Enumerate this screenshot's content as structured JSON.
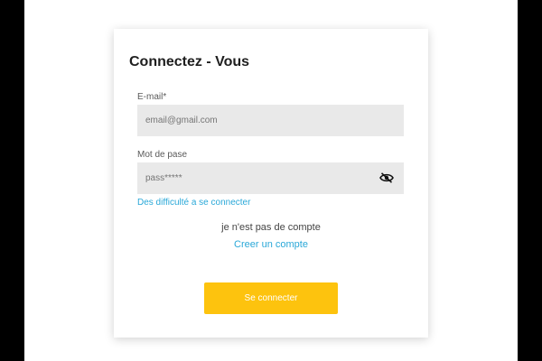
{
  "form": {
    "title": "Connectez - Vous",
    "email": {
      "label": "E-mail*",
      "placeholder": "email@gmail.com"
    },
    "password": {
      "label": "Mot de pase",
      "placeholder": "pass*****",
      "toggle_icon": "eye-off-icon"
    },
    "forgot_link": "Des difficulté a se connecter",
    "no_account_text": "je n'est pas de compte",
    "create_account_link": "Creer un compte",
    "submit_label": "Se connecter"
  },
  "colors": {
    "accent_button": "#fdc30e",
    "link": "#2aa8d8",
    "input_bg": "#e9e9e9"
  }
}
